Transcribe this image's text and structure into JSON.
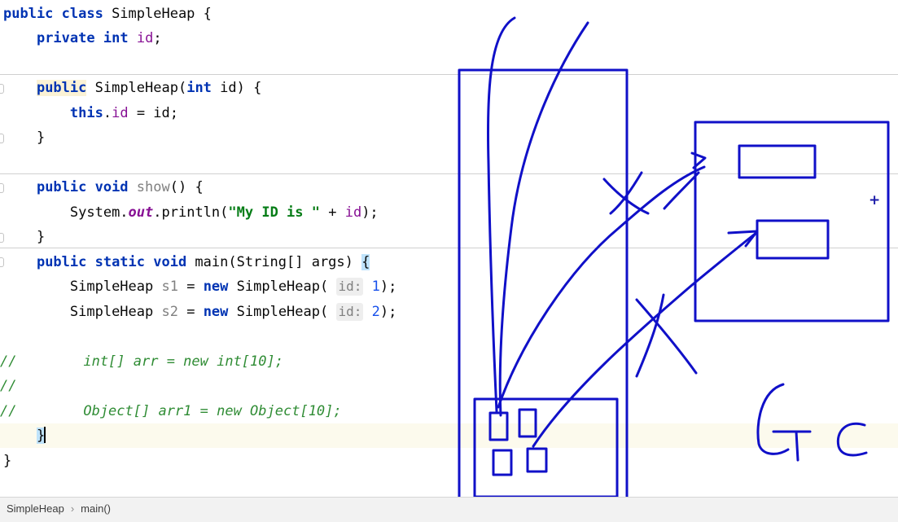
{
  "editor": {
    "line1": {
      "kw": "public class",
      "rest": " SimpleHeap {"
    },
    "line2": {
      "kw1": "private",
      "kw2": "int",
      "field": "id",
      "end": ";"
    },
    "line4": {
      "kw": "public",
      "rest": " SimpleHeap(",
      "kw2": "int",
      "rest2": " id) {"
    },
    "line5": {
      "kw": "this",
      "dot": ".",
      "field": "id",
      "rest": " = id;"
    },
    "line6": "}",
    "line8": {
      "kw": "public void",
      "name": "show",
      "rest": "() {"
    },
    "line9": {
      "pre": "System.",
      "static": "out",
      "mid": ".println(",
      "str": "\"My ID is \"",
      "plus": " + ",
      "field": "id",
      "end": ");"
    },
    "line10": "}",
    "line11": {
      "kw": "public static void",
      "rest": " main(String[] args) ",
      "brace": "{"
    },
    "line12": {
      "type": "SimpleHeap ",
      "var": "s1",
      "eq": " = ",
      "kw": "new",
      "ctor": " SimpleHeap( ",
      "hint": "id:",
      "num": "1",
      "end": ");"
    },
    "line13": {
      "type": "SimpleHeap ",
      "var": "s2",
      "eq": " = ",
      "kw": "new",
      "ctor": " SimpleHeap( ",
      "hint": "id:",
      "num": "2",
      "end": ");"
    },
    "line15": "//        int[] arr = new int[10];",
    "line16": "//",
    "line17": "//        Object[] arr1 = new Object[10];",
    "line18": "}",
    "line19": "}"
  },
  "annotation": {
    "handwritten_text": "GC",
    "ink_color": "#1010c8"
  },
  "breadcrumb": {
    "class": "SimpleHeap",
    "separator": "›",
    "method": "main()"
  },
  "icons": [
    "plus-icon",
    "chevron-right-icon"
  ]
}
